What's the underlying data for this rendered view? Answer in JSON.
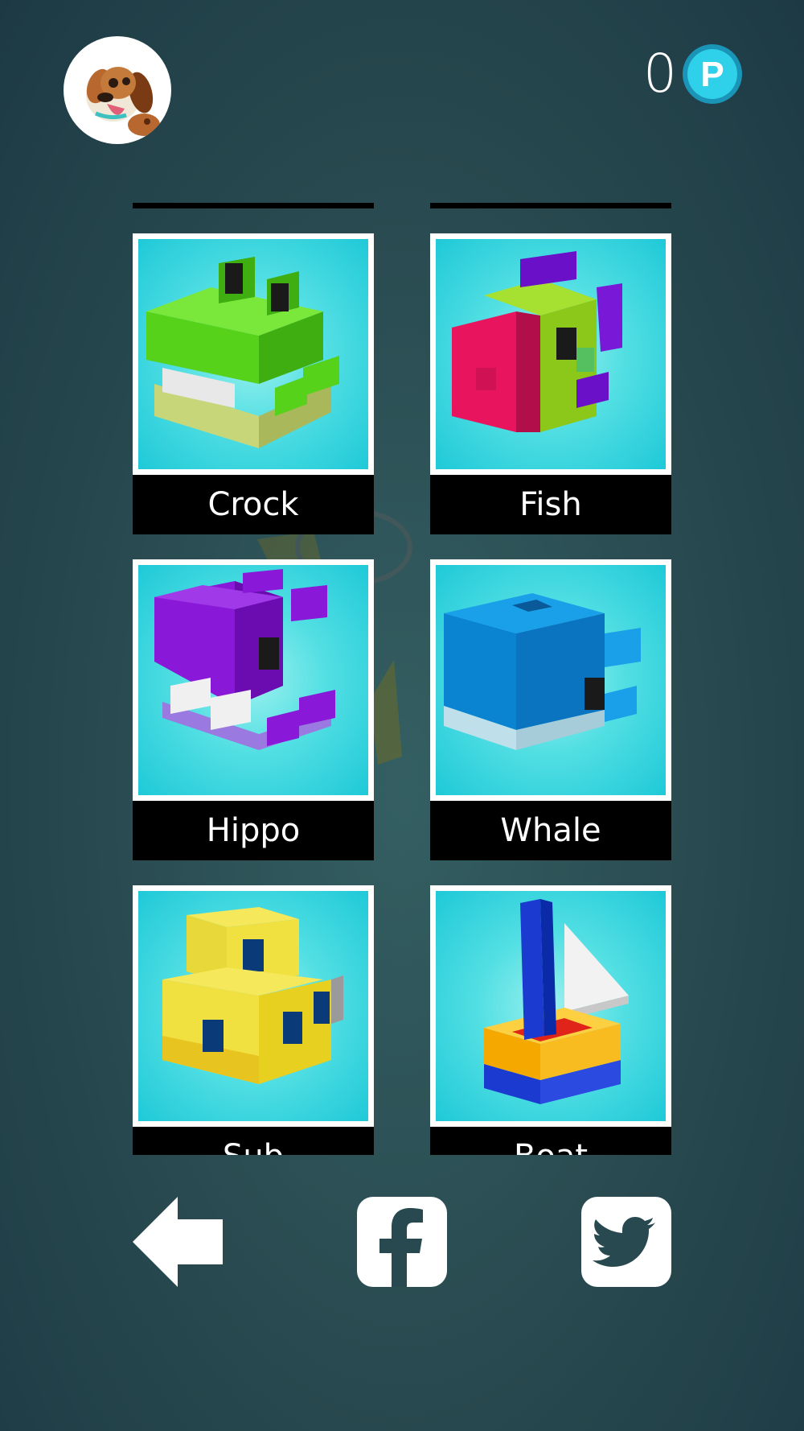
{
  "header": {
    "avatar_icon": "dog-avatar-icon",
    "coin_count": "0",
    "coin_icon": "p-coin-icon",
    "coin_letter": "P"
  },
  "animals": [
    {
      "name": "Crock",
      "icon": "crocodile-icon"
    },
    {
      "name": "Fish",
      "icon": "fish-icon"
    },
    {
      "name": "Hippo",
      "icon": "hippo-icon"
    },
    {
      "name": "Whale",
      "icon": "whale-icon"
    },
    {
      "name": "Sub",
      "icon": "submarine-icon"
    },
    {
      "name": "Boat",
      "icon": "sailboat-icon"
    }
  ],
  "footer": {
    "back_icon": "back-arrow-icon",
    "facebook_icon": "facebook-icon",
    "twitter_icon": "twitter-icon"
  },
  "colors": {
    "background": "#28494f",
    "card_bg": "#52dfe3",
    "label_bg": "#000000",
    "coin": "#1fb8d8"
  }
}
